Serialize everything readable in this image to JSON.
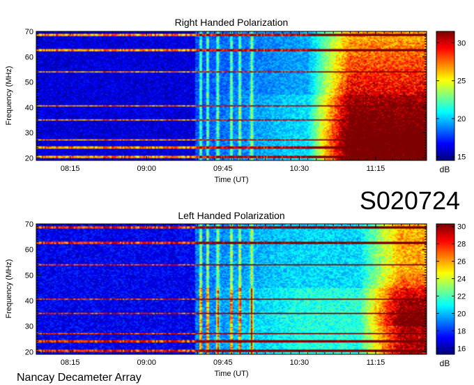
{
  "page": {
    "station_code": "S020724",
    "observatory": "Nancay Decameter Array"
  },
  "chart_data": [
    {
      "type": "heatmap",
      "title": "Right Handed Polarization",
      "xlabel": "Time (UT)",
      "ylabel": "Frequency (MHz)",
      "xlim": [
        "07:55",
        "11:45"
      ],
      "ylim": [
        19,
        70
      ],
      "xticks": [
        "08:15",
        "09:00",
        "09:45",
        "10:30",
        "11:15"
      ],
      "yticks": [
        20,
        30,
        40,
        50,
        60,
        70
      ],
      "colorbar": {
        "label": "dB",
        "range": [
          14.5,
          31.5
        ],
        "ticks": [
          15,
          20,
          25,
          30
        ]
      },
      "colormap": [
        "#00007f",
        "#0000ff",
        "#007fff",
        "#00ffff",
        "#7fff7f",
        "#ffff00",
        "#ff7f00",
        "#ff0000",
        "#7f0000"
      ],
      "features": {
        "storm_start": "10:35",
        "storm_peak_db": 31,
        "background_db": 16,
        "broadband_bursts": [
          "09:32",
          "09:36",
          "09:42",
          "09:50",
          "09:55",
          "10:02"
        ],
        "interference_freqs_mhz": [
          20.5,
          24,
          27,
          35,
          40.5,
          54,
          62.5,
          68.5
        ]
      }
    },
    {
      "type": "heatmap",
      "title": "Left Handed Polarization",
      "xlabel": "Time (UT)",
      "ylabel": "Frequency (MHz)",
      "xlim": [
        "07:55",
        "11:45"
      ],
      "ylim": [
        19,
        70
      ],
      "xticks": [
        "08:15",
        "09:00",
        "09:45",
        "10:30",
        "11:15"
      ],
      "yticks": [
        20,
        30,
        40,
        50,
        60,
        70
      ],
      "colorbar": {
        "label": "dB",
        "range": [
          15.3,
          30.3
        ],
        "ticks": [
          16,
          18,
          20,
          22,
          24,
          26,
          28,
          30
        ]
      },
      "colormap": [
        "#00007f",
        "#0000ff",
        "#007fff",
        "#00ffff",
        "#7fff7f",
        "#ffff00",
        "#ff7f00",
        "#ff0000",
        "#7f0000"
      ],
      "features": {
        "storm_start": "11:05",
        "storm_peak_db": 29,
        "background_db": 17,
        "broadband_bursts": [
          "09:32",
          "09:36",
          "09:42",
          "09:50",
          "09:55",
          "10:02"
        ],
        "interference_freqs_mhz": [
          20.5,
          24,
          27,
          35,
          40.5,
          54,
          62.5,
          68.5
        ]
      }
    }
  ]
}
